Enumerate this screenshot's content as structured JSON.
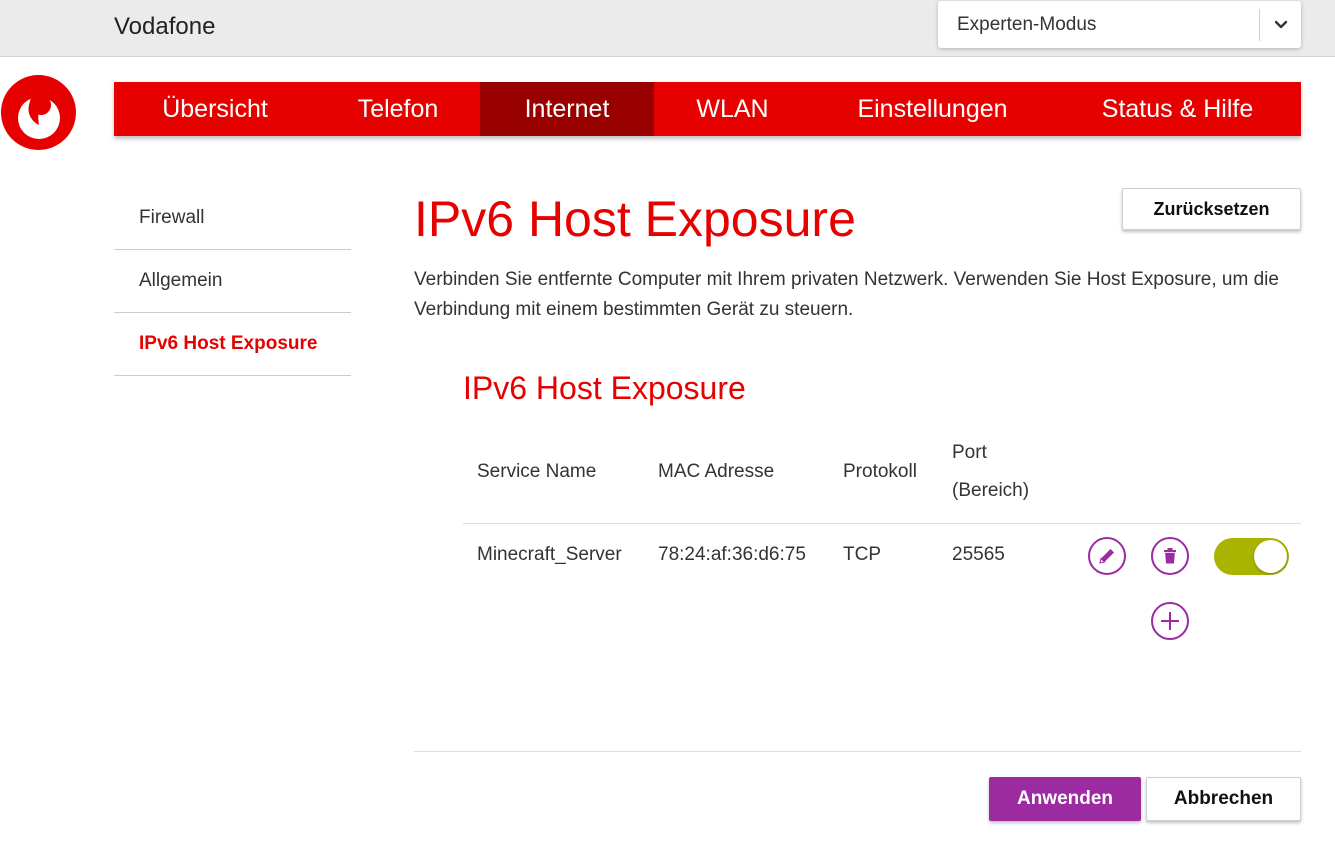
{
  "header": {
    "brand": "Vodafone",
    "mode_select": {
      "value": "Experten-Modus",
      "icon": "chevron-down-icon"
    }
  },
  "logo": {
    "icon": "vodafone-logo",
    "color": "#e60000"
  },
  "nav": {
    "items": [
      {
        "label": "Übersicht",
        "active": false
      },
      {
        "label": "Telefon",
        "active": false
      },
      {
        "label": "Internet",
        "active": true
      },
      {
        "label": "WLAN",
        "active": false
      },
      {
        "label": "Einstellungen",
        "active": false
      },
      {
        "label": "Status & Hilfe",
        "active": false
      }
    ]
  },
  "sidebar": {
    "items": [
      {
        "label": "Firewall",
        "active": false
      },
      {
        "label": "Allgemein",
        "active": false
      },
      {
        "label": "IPv6 Host Exposure",
        "active": true
      }
    ]
  },
  "main": {
    "title": "IPv6 Host Exposure",
    "reset_label": "Zurücksetzen",
    "intro": "Verbinden Sie entfernte Computer mit Ihrem privaten Netzwerk. Verwenden Sie Host Exposure, um die Verbindung mit einem bestimmten Gerät zu steuern.",
    "section_title": "IPv6 Host Exposure",
    "table": {
      "headers": {
        "service": "Service Name",
        "mac": "MAC Adresse",
        "protocol": "Protokoll",
        "port_line1": "Port",
        "port_line2": "(Bereich)"
      },
      "rows": [
        {
          "service": "Minecraft_Server",
          "mac": "78:24:af:36:d6:75",
          "protocol": "TCP",
          "port": "25565",
          "enabled": true
        }
      ]
    },
    "apply_label": "Anwenden",
    "cancel_label": "Abbrechen"
  },
  "colors": {
    "brand_red": "#e60000",
    "nav_active": "#990000",
    "accent_purple": "#9c2aa0",
    "toggle_on": "#a8b400"
  }
}
